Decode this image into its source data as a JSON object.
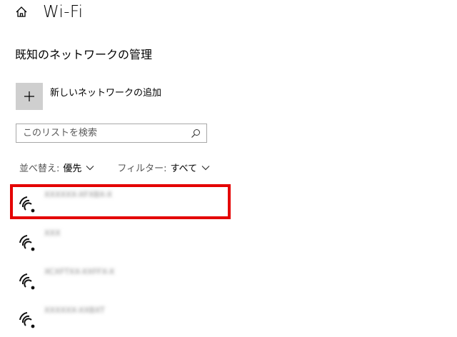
{
  "header": {
    "title": "Wi-Fi",
    "icon": "home-icon"
  },
  "section": {
    "title": "既知のネットワークの管理"
  },
  "add_network": {
    "label": "新しいネットワークの追加",
    "icon": "plus-icon"
  },
  "search": {
    "placeholder": "このリストを検索",
    "value": "",
    "icon": "search-icon"
  },
  "sort": {
    "label": "並べ替え:",
    "value": "優先"
  },
  "filter": {
    "label": "フィルター:",
    "value": "すべて"
  },
  "networks": [
    {
      "ssid": "XXXXXX-XFXBX-X",
      "selected": true
    },
    {
      "ssid": "XXX",
      "selected": false
    },
    {
      "ssid": "XCXFTXX-XXFFX-X",
      "selected": false
    },
    {
      "ssid": "XXXXXX-XXBXT",
      "selected": false
    }
  ],
  "colors": {
    "highlight": "#e40000",
    "tile": "#cfcfcf",
    "border": "#a8a8a8"
  }
}
